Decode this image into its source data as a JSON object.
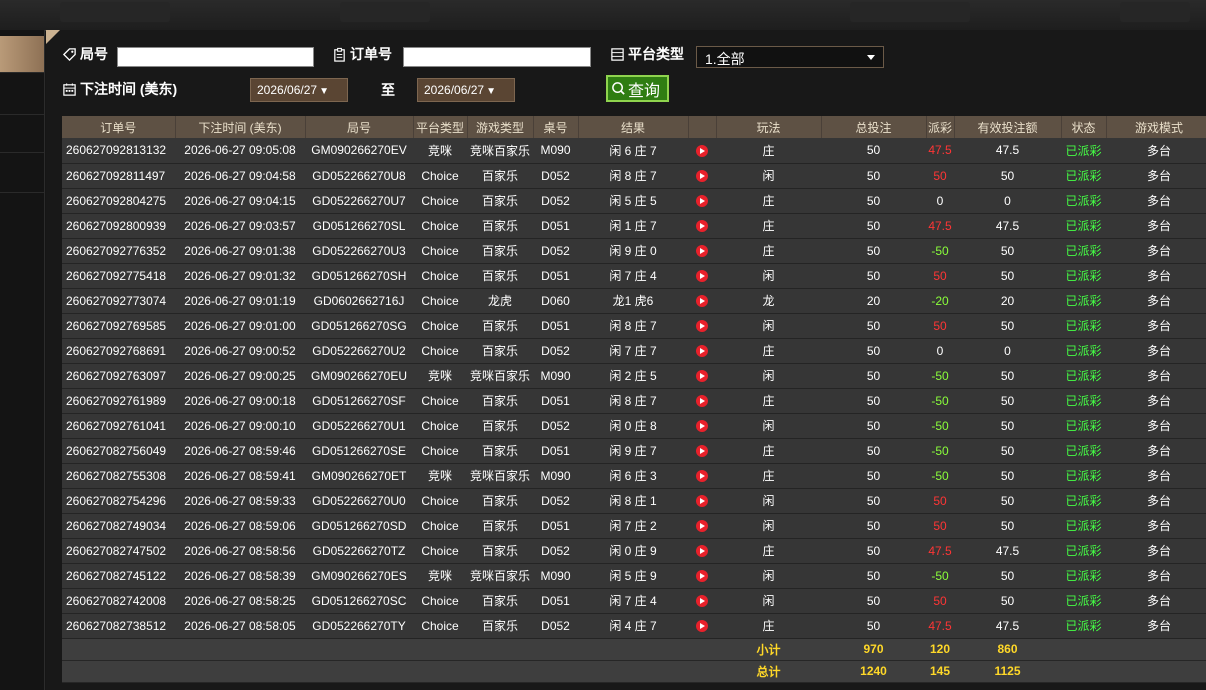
{
  "filters": {
    "round_label": "局号",
    "round_value": "",
    "order_label": "订单号",
    "order_value": "",
    "platform_label": "平台类型",
    "platform_selected": "1.全部",
    "time_label": "下注时间 (美东)",
    "date_from": "2026/06/27",
    "to_label": "至",
    "date_to": "2026/06/27",
    "query_button": "查询"
  },
  "table": {
    "headers": [
      "订单号",
      "下注时间 (美东)",
      "局号",
      "平台类型",
      "游戏类型",
      "桌号",
      "结果",
      "",
      "玩法",
      "总投注",
      "派彩",
      "有效投注额",
      "状态",
      "游戏模式"
    ],
    "rows": [
      [
        "260627092813132",
        "2026-06-27 09:05:08",
        "GM090266270EV",
        "竞咪",
        "竞咪百家乐",
        "M090",
        "闲 6 庄 7",
        "庄",
        "50",
        "47.5",
        "47.5",
        "已派彩",
        "多台"
      ],
      [
        "260627092811497",
        "2026-06-27 09:04:58",
        "GD052266270U8",
        "Choice",
        "百家乐",
        "D052",
        "闲 8 庄 7",
        "闲",
        "50",
        "50",
        "50",
        "已派彩",
        "多台"
      ],
      [
        "260627092804275",
        "2026-06-27 09:04:15",
        "GD052266270U7",
        "Choice",
        "百家乐",
        "D052",
        "闲 5 庄 5",
        "庄",
        "50",
        "0",
        "0",
        "已派彩",
        "多台"
      ],
      [
        "260627092800939",
        "2026-06-27 09:03:57",
        "GD051266270SL",
        "Choice",
        "百家乐",
        "D051",
        "闲 1 庄 7",
        "庄",
        "50",
        "47.5",
        "47.5",
        "已派彩",
        "多台"
      ],
      [
        "260627092776352",
        "2026-06-27 09:01:38",
        "GD052266270U3",
        "Choice",
        "百家乐",
        "D052",
        "闲 9 庄 0",
        "庄",
        "50",
        "-50",
        "50",
        "已派彩",
        "多台"
      ],
      [
        "260627092775418",
        "2026-06-27 09:01:32",
        "GD051266270SH",
        "Choice",
        "百家乐",
        "D051",
        "闲 7 庄 4",
        "闲",
        "50",
        "50",
        "50",
        "已派彩",
        "多台"
      ],
      [
        "260627092773074",
        "2026-06-27 09:01:19",
        "GD0602662716J",
        "Choice",
        "龙虎",
        "D060",
        "龙1 虎6",
        "龙",
        "20",
        "-20",
        "20",
        "已派彩",
        "多台"
      ],
      [
        "260627092769585",
        "2026-06-27 09:01:00",
        "GD051266270SG",
        "Choice",
        "百家乐",
        "D051",
        "闲 8 庄 7",
        "闲",
        "50",
        "50",
        "50",
        "已派彩",
        "多台"
      ],
      [
        "260627092768691",
        "2026-06-27 09:00:52",
        "GD052266270U2",
        "Choice",
        "百家乐",
        "D052",
        "闲 7 庄 7",
        "庄",
        "50",
        "0",
        "0",
        "已派彩",
        "多台"
      ],
      [
        "260627092763097",
        "2026-06-27 09:00:25",
        "GM090266270EU",
        "竞咪",
        "竞咪百家乐",
        "M090",
        "闲 2 庄 5",
        "闲",
        "50",
        "-50",
        "50",
        "已派彩",
        "多台"
      ],
      [
        "260627092761989",
        "2026-06-27 09:00:18",
        "GD051266270SF",
        "Choice",
        "百家乐",
        "D051",
        "闲 8 庄 7",
        "庄",
        "50",
        "-50",
        "50",
        "已派彩",
        "多台"
      ],
      [
        "260627092761041",
        "2026-06-27 09:00:10",
        "GD052266270U1",
        "Choice",
        "百家乐",
        "D052",
        "闲 0 庄 8",
        "闲",
        "50",
        "-50",
        "50",
        "已派彩",
        "多台"
      ],
      [
        "260627082756049",
        "2026-06-27 08:59:46",
        "GD051266270SE",
        "Choice",
        "百家乐",
        "D051",
        "闲 9 庄 7",
        "庄",
        "50",
        "-50",
        "50",
        "已派彩",
        "多台"
      ],
      [
        "260627082755308",
        "2026-06-27 08:59:41",
        "GM090266270ET",
        "竞咪",
        "竞咪百家乐",
        "M090",
        "闲 6 庄 3",
        "庄",
        "50",
        "-50",
        "50",
        "已派彩",
        "多台"
      ],
      [
        "260627082754296",
        "2026-06-27 08:59:33",
        "GD052266270U0",
        "Choice",
        "百家乐",
        "D052",
        "闲 8 庄 1",
        "闲",
        "50",
        "50",
        "50",
        "已派彩",
        "多台"
      ],
      [
        "260627082749034",
        "2026-06-27 08:59:06",
        "GD051266270SD",
        "Choice",
        "百家乐",
        "D051",
        "闲 7 庄 2",
        "闲",
        "50",
        "50",
        "50",
        "已派彩",
        "多台"
      ],
      [
        "260627082747502",
        "2026-06-27 08:58:56",
        "GD052266270TZ",
        "Choice",
        "百家乐",
        "D052",
        "闲 0 庄 9",
        "庄",
        "50",
        "47.5",
        "47.5",
        "已派彩",
        "多台"
      ],
      [
        "260627082745122",
        "2026-06-27 08:58:39",
        "GM090266270ES",
        "竞咪",
        "竞咪百家乐",
        "M090",
        "闲 5 庄 9",
        "闲",
        "50",
        "-50",
        "50",
        "已派彩",
        "多台"
      ],
      [
        "260627082742008",
        "2026-06-27 08:58:25",
        "GD051266270SC",
        "Choice",
        "百家乐",
        "D051",
        "闲 7 庄 4",
        "闲",
        "50",
        "50",
        "50",
        "已派彩",
        "多台"
      ],
      [
        "260627082738512",
        "2026-06-27 08:58:05",
        "GD052266270TY",
        "Choice",
        "百家乐",
        "D052",
        "闲 4 庄 7",
        "庄",
        "50",
        "47.5",
        "47.5",
        "已派彩",
        "多台"
      ]
    ],
    "subtotal": {
      "label": "小计",
      "bet": "970",
      "payout": "120",
      "valid": "860"
    },
    "total": {
      "label": "总计",
      "bet": "1240",
      "payout": "145",
      "valid": "1125"
    }
  },
  "colors": {
    "payout_win": "#ff3535",
    "payout_loss": "#8aff3a",
    "status": "#44ff44",
    "summary": "#ffd828",
    "header": "#5e5144"
  }
}
